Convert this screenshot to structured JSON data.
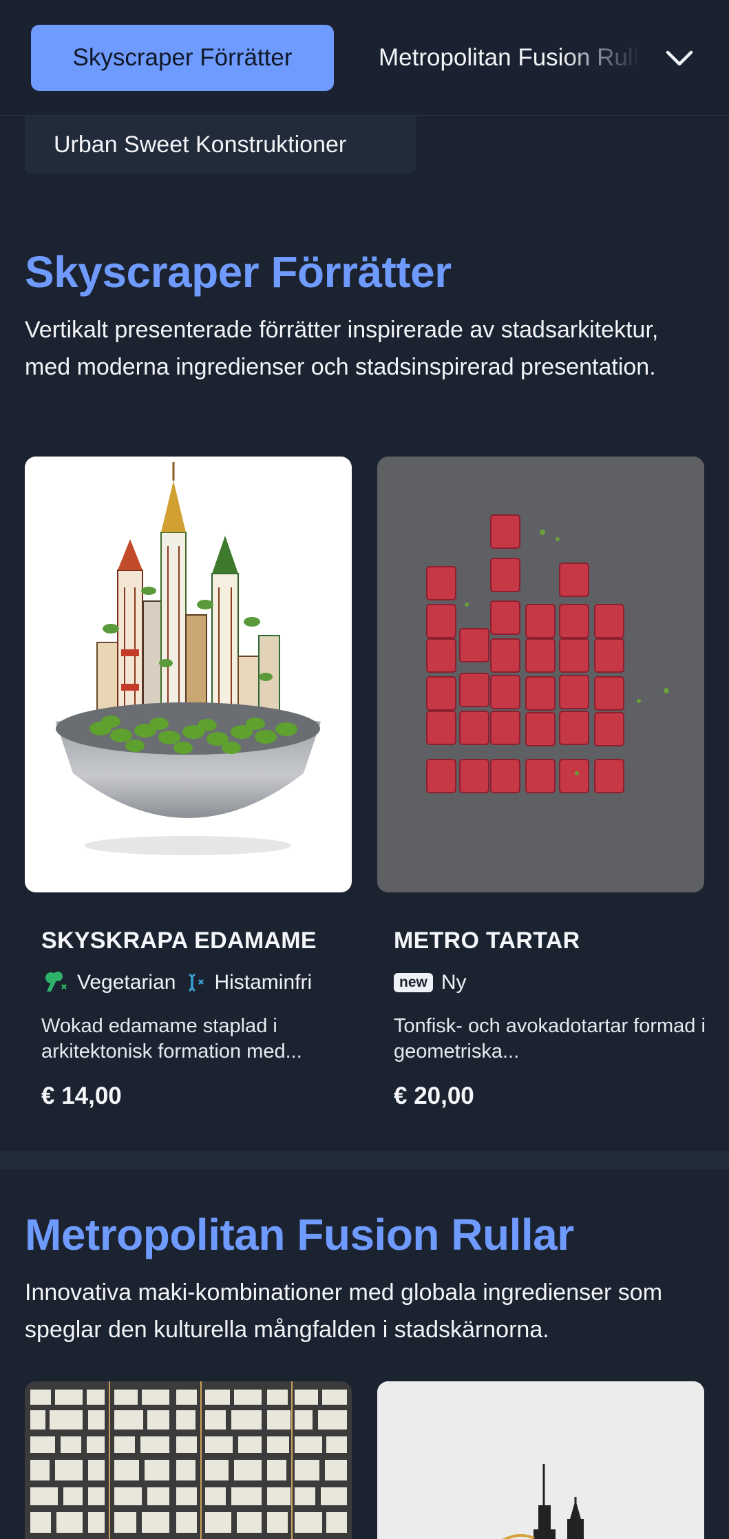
{
  "nav": {
    "active_tab": "Skyscraper Förrätter",
    "next_tab": "Metropolitan Fusion Rullar",
    "second_row_tab": "Urban Sweet Konstruktioner",
    "expand_icon": "chevron-down-icon"
  },
  "sections": [
    {
      "title": "Skyscraper Förrätter",
      "description": "Vertikalt presenterade förrätter inspirerade av stadsarkitektur, med moderna ingredienser och stadsinspirerad presentation.",
      "items": [
        {
          "name": "SKYSKRAPA EDAMAME",
          "tags": [
            {
              "icon": "broccoli-icon",
              "label": "Vegetarian"
            },
            {
              "icon": "dna-icon",
              "label": "Histaminfri"
            }
          ],
          "description": "Wokad edamame staplad i arkitektonisk formation med...",
          "price": "€ 14,00"
        },
        {
          "name": "METRO TARTAR",
          "tags": [
            {
              "icon": "new-badge",
              "badge": "new",
              "label": "Ny"
            }
          ],
          "description": "Tonfisk- och avokadotartar formad i geometriska...",
          "price": "€ 20,00"
        }
      ]
    },
    {
      "title": "Metropolitan Fusion Rullar",
      "description": "Innovativa maki-kombinationer med globala ingredienser som speglar den kulturella mångfalden i stadskärnorna."
    }
  ],
  "colors": {
    "background": "#1b2230",
    "accent": "#6f9bff",
    "vegetarian_icon": "#2fb36b",
    "histamine_icon": "#3aa6d8"
  }
}
